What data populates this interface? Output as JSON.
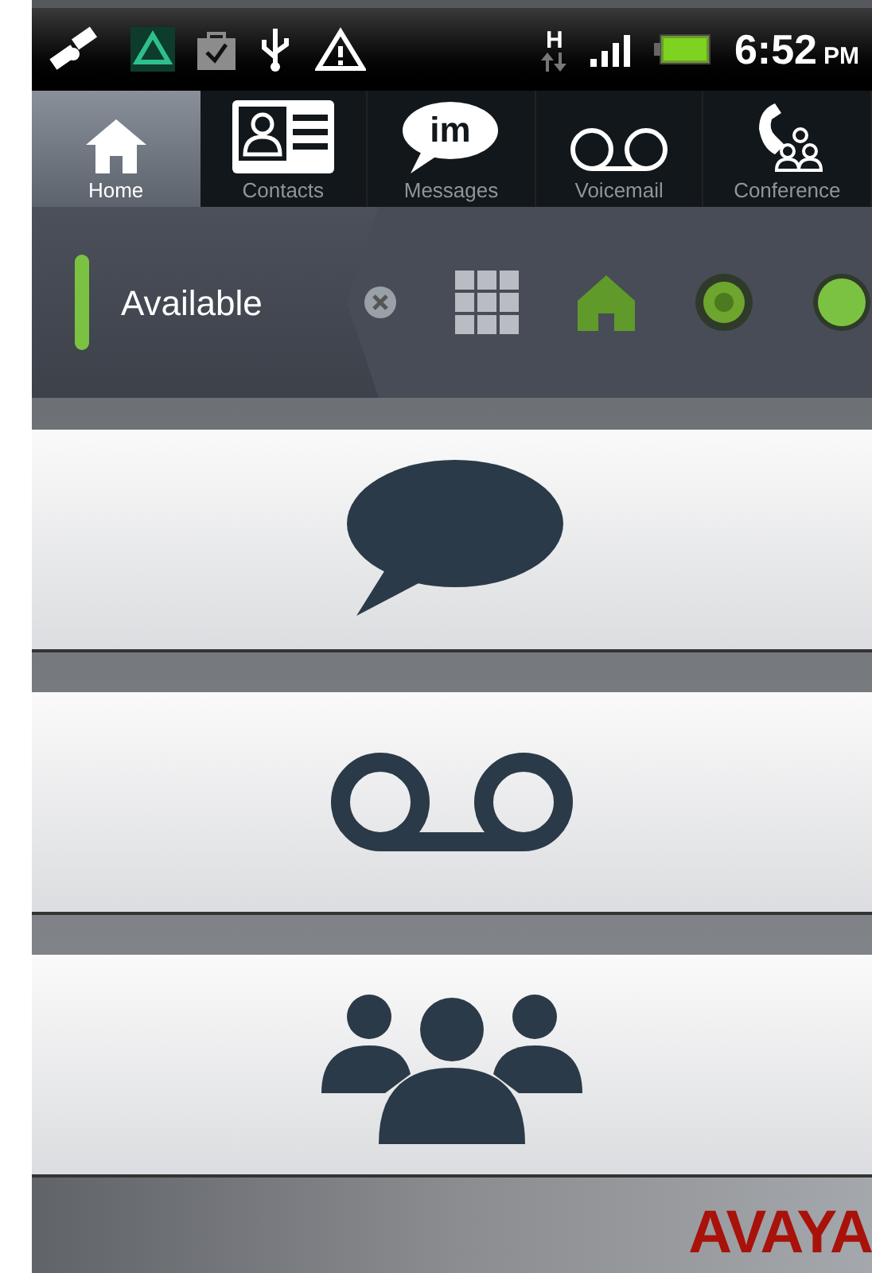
{
  "status_bar": {
    "time": "6:52",
    "meridiem": "PM",
    "network": "H"
  },
  "tabs": [
    {
      "kind": "home",
      "label": "Home",
      "selected": true
    },
    {
      "kind": "contacts",
      "label": "Contacts",
      "selected": false
    },
    {
      "kind": "messages",
      "label": "Messages",
      "selected": false,
      "icon_text": "im"
    },
    {
      "kind": "voicemail",
      "label": "Voicemail",
      "selected": false
    },
    {
      "kind": "conference",
      "label": "Conference",
      "selected": false
    }
  ],
  "presence": {
    "status": "Available",
    "color": "#7cc242"
  },
  "tiles": [
    {
      "kind": "messages"
    },
    {
      "kind": "voicemail"
    },
    {
      "kind": "conference"
    }
  ],
  "footer": {
    "logo": "AVAYA"
  }
}
